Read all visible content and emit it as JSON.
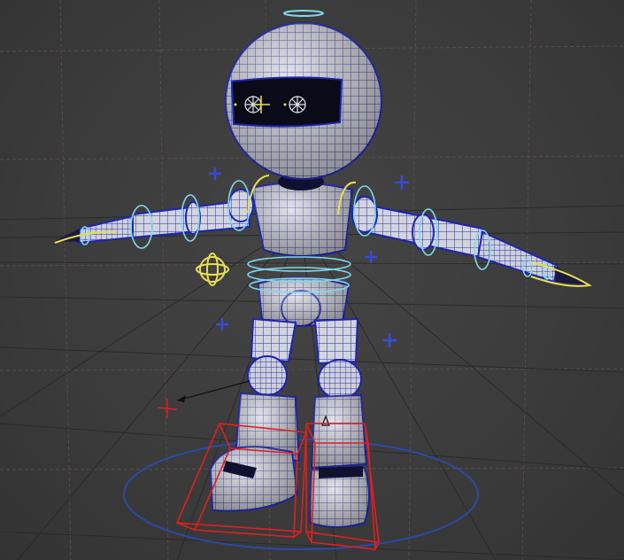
{
  "viewport": {
    "panel": "perspective-viewport",
    "display_mode": "wireframe-on-shaded"
  },
  "colors": {
    "background": "#3b3b3b",
    "grid_line": "#5a4848",
    "grid_axis": "#222222",
    "wireframe": "#1c24b0",
    "shaded_mesh": "#d4d4dc",
    "fk_controls": "#7ed8f0",
    "ik_controls": "#e8e050",
    "pole_vectors": "#3a4ad8",
    "foot_controls": "#e02020",
    "root_circle": "#2a4aa8",
    "visor": "#0a0a18"
  },
  "scene": {
    "character": "robot-rig",
    "icons": [
      "head-control-icon",
      "eye-icon",
      "pole-vector-icon",
      "cog-control-icon",
      "ik-handle-icon",
      "foot-ik-icon",
      "root-control-icon"
    ]
  }
}
